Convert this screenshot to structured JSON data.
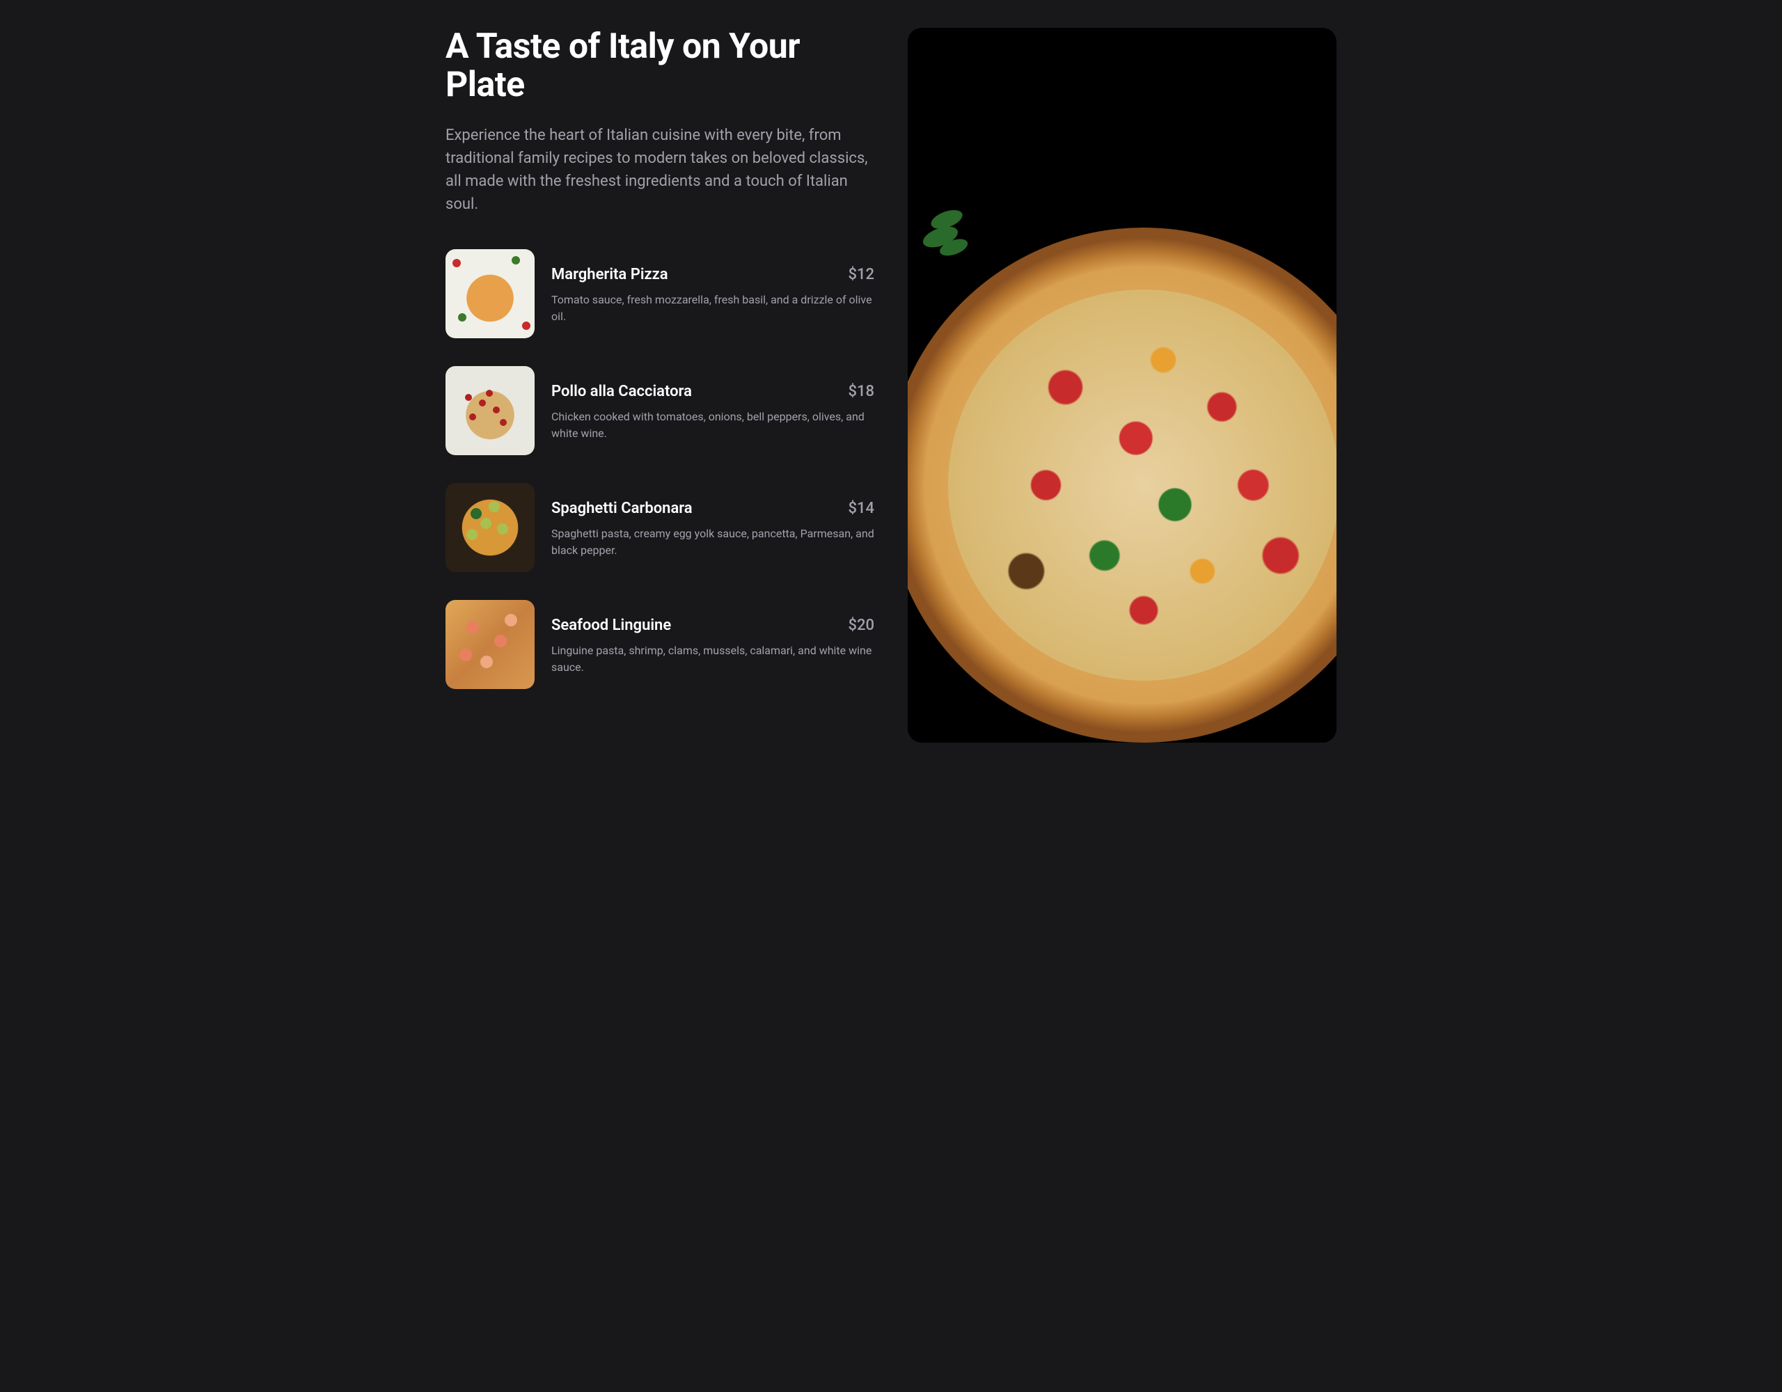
{
  "hero": {
    "title": "A Taste of Italy on Your Plate",
    "subtitle": "Experience the heart of Italian cuisine with every bite, from traditional family recipes to modern takes on beloved classics, all made with the freshest ingredients and a touch of Italian soul."
  },
  "menu": [
    {
      "name": "Margherita Pizza",
      "price": "$12",
      "description": "Tomato sauce, fresh mozzarella, fresh basil, and a drizzle of olive oil."
    },
    {
      "name": "Pollo alla Cacciatora",
      "price": "$18",
      "description": "Chicken cooked with tomatoes, onions, bell peppers, olives, and white wine."
    },
    {
      "name": "Spaghetti Carbonara",
      "price": "$14",
      "description": "Spaghetti pasta, creamy egg yolk sauce, pancetta, Parmesan, and black pepper."
    },
    {
      "name": "Seafood Linguine",
      "price": "$20",
      "description": "Linguine pasta, shrimp, clams, mussels, calamari, and white wine sauce."
    }
  ]
}
